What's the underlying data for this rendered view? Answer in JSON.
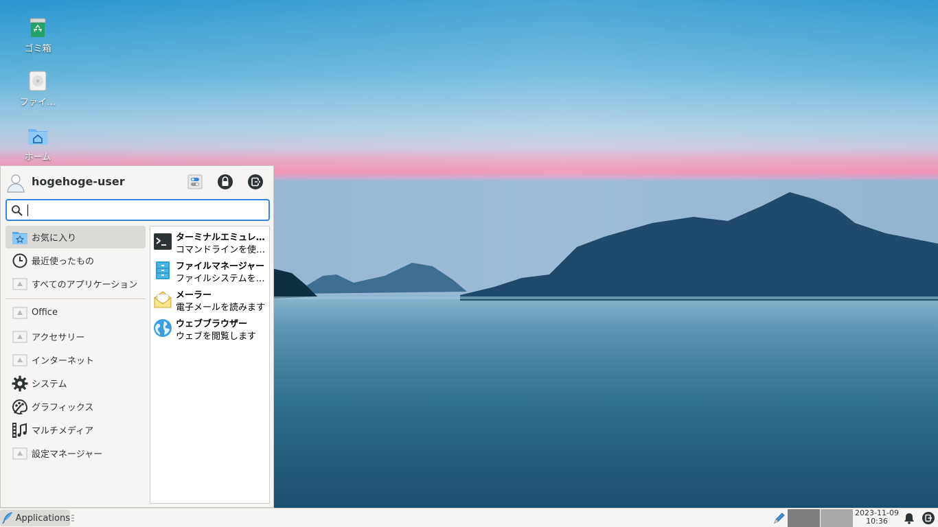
{
  "desktop": {
    "icons": [
      {
        "label": "ゴミ箱",
        "icon": "trash-icon"
      },
      {
        "label": "ファイ…",
        "icon": "drive-icon"
      },
      {
        "label": "ホーム",
        "icon": "home-folder-icon"
      }
    ]
  },
  "menu": {
    "user_name": "hogehoge-user",
    "search": {
      "value": "",
      "placeholder": ""
    },
    "categories": [
      {
        "label": "お気に入り",
        "icon": "favorites-icon",
        "selected": true
      },
      {
        "label": "最近使ったもの",
        "icon": "clock-icon"
      },
      {
        "label": "すべてのアプリケーション",
        "icon": "missing-image-icon"
      },
      {
        "label": "Office",
        "icon": "missing-image-icon"
      },
      {
        "label": "アクセサリー",
        "icon": "missing-image-icon"
      },
      {
        "label": "インターネット",
        "icon": "missing-image-icon"
      },
      {
        "label": "システム",
        "icon": "gear-icon"
      },
      {
        "label": "グラフィックス",
        "icon": "palette-icon"
      },
      {
        "label": "マルチメディア",
        "icon": "multimedia-icon"
      },
      {
        "label": "設定マネージャー",
        "icon": "missing-image-icon"
      }
    ],
    "apps": [
      {
        "name": "ターミナルエミュレ…",
        "desc": "コマンドラインを使…",
        "icon": "terminal-icon"
      },
      {
        "name": "ファイルマネージャー",
        "desc": "ファイルシステムを…",
        "icon": "file-manager-icon"
      },
      {
        "name": "メーラー",
        "desc": "電子メールを読みます",
        "icon": "mail-icon"
      },
      {
        "name": "ウェブブラウザー",
        "desc": "ウェブを閲覧します",
        "icon": "globe-icon"
      }
    ]
  },
  "panel": {
    "apps_button_label": "Applications",
    "clock": {
      "date": "2023-11-09",
      "time": "10:36"
    }
  },
  "colors": {
    "accent": "#3584e4",
    "selected_bg": "#dcdad7",
    "panel_bg": "#f6f5f4"
  }
}
